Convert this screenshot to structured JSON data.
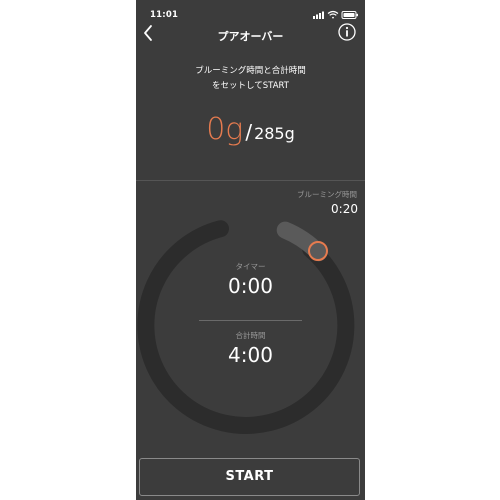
{
  "status_bar": {
    "time": "11:01",
    "icons": [
      "signal-icon",
      "wifi-icon",
      "battery-icon"
    ]
  },
  "nav": {
    "title": "プアオーバー",
    "back_icon": "chevron-left-icon",
    "info_icon": "info-icon"
  },
  "instruction": {
    "line1": "ブルーミング時間と合計時間",
    "line2": "をセットしてSTART"
  },
  "weight": {
    "current": "0g",
    "separator": "/",
    "target": "285g"
  },
  "bloom": {
    "label": "ブルーミング時間",
    "value": "0:20"
  },
  "timer": {
    "label": "タイマー",
    "value": "0:00"
  },
  "total": {
    "label": "合計時間",
    "value": "4:00"
  },
  "start_button": {
    "label": "START"
  },
  "colors": {
    "background": "#3c3c3c",
    "accent": "#e67b4f",
    "ring": "#2c2c2c",
    "bloom_segment": "#5a5a5a",
    "muted_text": "#9a9a9a"
  }
}
